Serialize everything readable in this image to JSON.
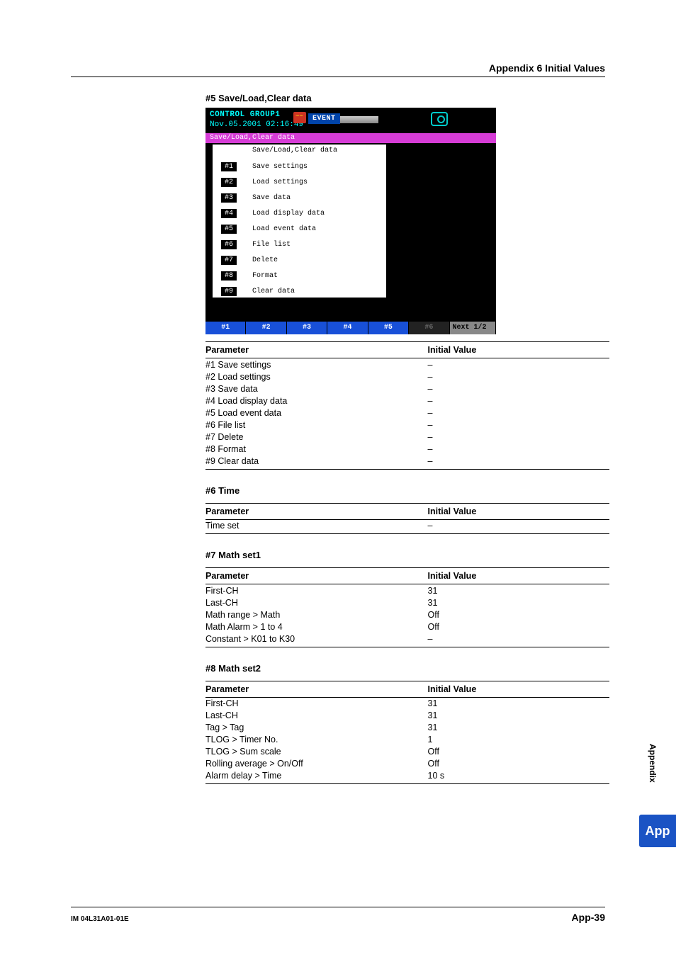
{
  "headerRight": "Appendix 6  Initial Values",
  "footer": {
    "doc": "IM 04L31A01-01E",
    "page": "App-39"
  },
  "side": {
    "label": "Appendix",
    "tab": "App"
  },
  "screenshot": {
    "cg": "CONTROL GROUP1",
    "ts": "Nov.05.2001 02:16:49",
    "event": "EVENT",
    "magenta": "Save/Load,Clear data",
    "panelTitle": "Save/Load,Clear data",
    "menu": [
      {
        "n": "#1",
        "t": "Save settings"
      },
      {
        "n": "#2",
        "t": "Load settings"
      },
      {
        "n": "#3",
        "t": "Save data"
      },
      {
        "n": "#4",
        "t": "Load display data"
      },
      {
        "n": "#5",
        "t": "Load event data"
      },
      {
        "n": "#6",
        "t": "File list"
      },
      {
        "n": "#7",
        "t": "Delete"
      },
      {
        "n": "#8",
        "t": "Format"
      },
      {
        "n": "#9",
        "t": "Clear data"
      }
    ],
    "soft": [
      "#1",
      "#2",
      "#3",
      "#4",
      "#5",
      "#6",
      "Next 1/2"
    ]
  },
  "sections": [
    {
      "title": "#5 Save/Load,Clear data",
      "hasShot": true,
      "header": [
        "Parameter",
        "Initial Value"
      ],
      "rows": [
        {
          "p": "#1 Save settings",
          "v": "–"
        },
        {
          "p": "#2 Load settings",
          "v": "–"
        },
        {
          "p": "#3 Save data",
          "v": "–"
        },
        {
          "p": "#4 Load display data",
          "v": "–"
        },
        {
          "p": "#5 Load event data",
          "v": "–"
        },
        {
          "p": "#6 File list",
          "v": "–"
        },
        {
          "p": "#7 Delete",
          "v": "–"
        },
        {
          "p": "#8 Format",
          "v": "–"
        },
        {
          "p": "#9 Clear data",
          "v": "–"
        }
      ]
    },
    {
      "title": "#6 Time",
      "header": [
        "Parameter",
        "Initial Value"
      ],
      "rows": [
        {
          "p": "Time set",
          "v": "–"
        }
      ]
    },
    {
      "title": "#7 Math set1",
      "header": [
        "Parameter",
        "Initial Value"
      ],
      "rows": [
        {
          "p": "First-CH",
          "v": "31"
        },
        {
          "p": "Last-CH",
          "v": "31"
        },
        {
          "p": "Math range > Math",
          "v": "Off"
        },
        {
          "p": "Math Alarm > 1 to 4",
          "v": "Off"
        },
        {
          "p": "Constant > K01 to K30",
          "v": "–"
        }
      ]
    },
    {
      "title": "#8 Math set2",
      "header": [
        "Parameter",
        "Initial Value"
      ],
      "rows": [
        {
          "p": "First-CH",
          "v": "31"
        },
        {
          "p": "Last-CH",
          "v": "31"
        },
        {
          "p": "Tag > Tag",
          "v": "31"
        },
        {
          "p": "TLOG > Timer No.",
          "v": "1"
        },
        {
          "p": "TLOG > Sum scale",
          "v": "Off"
        },
        {
          "p": "Rolling average > On/Off",
          "v": "Off"
        },
        {
          "p": "Alarm delay > Time",
          "v": "10 s"
        }
      ]
    }
  ]
}
